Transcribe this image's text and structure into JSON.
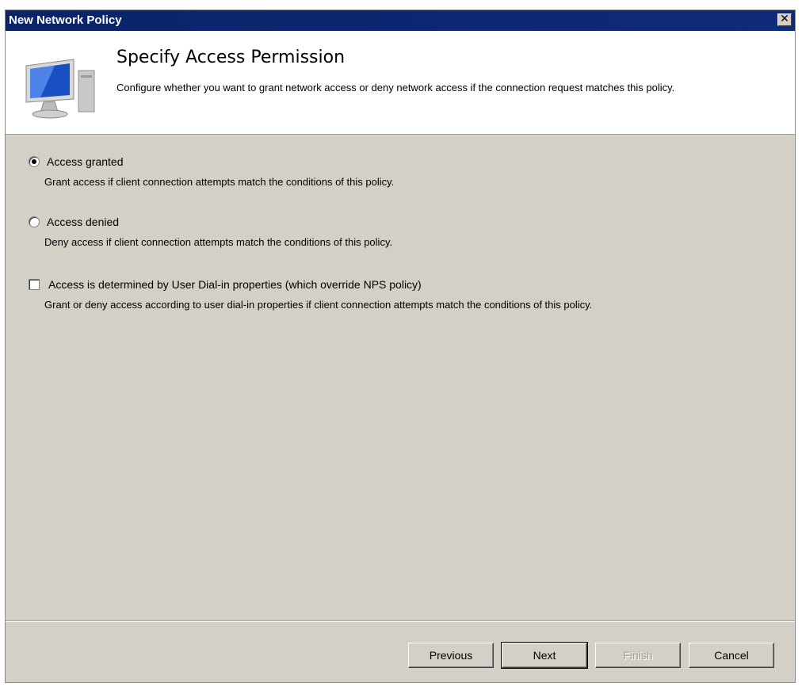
{
  "window": {
    "title": "New Network Policy",
    "close_glyph": "✕"
  },
  "header": {
    "title": "Specify Access Permission",
    "description": "Configure whether you want to grant network access or deny network access if the connection request matches this policy.",
    "icon": "network-computer-icon"
  },
  "options": {
    "granted": {
      "label": "Access granted",
      "description": "Grant access if client connection attempts match the conditions of this policy.",
      "selected": true
    },
    "denied": {
      "label": "Access denied",
      "description": "Deny access if client connection attempts match the conditions of this policy.",
      "selected": false
    },
    "dialin": {
      "label": "Access is determined by User Dial-in properties (which override NPS policy)",
      "description": "Grant or deny access according to user dial-in properties if client connection attempts match the conditions of this policy.",
      "checked": false
    }
  },
  "buttons": {
    "previous": "Previous",
    "next": "Next",
    "finish": "Finish",
    "cancel": "Cancel"
  }
}
